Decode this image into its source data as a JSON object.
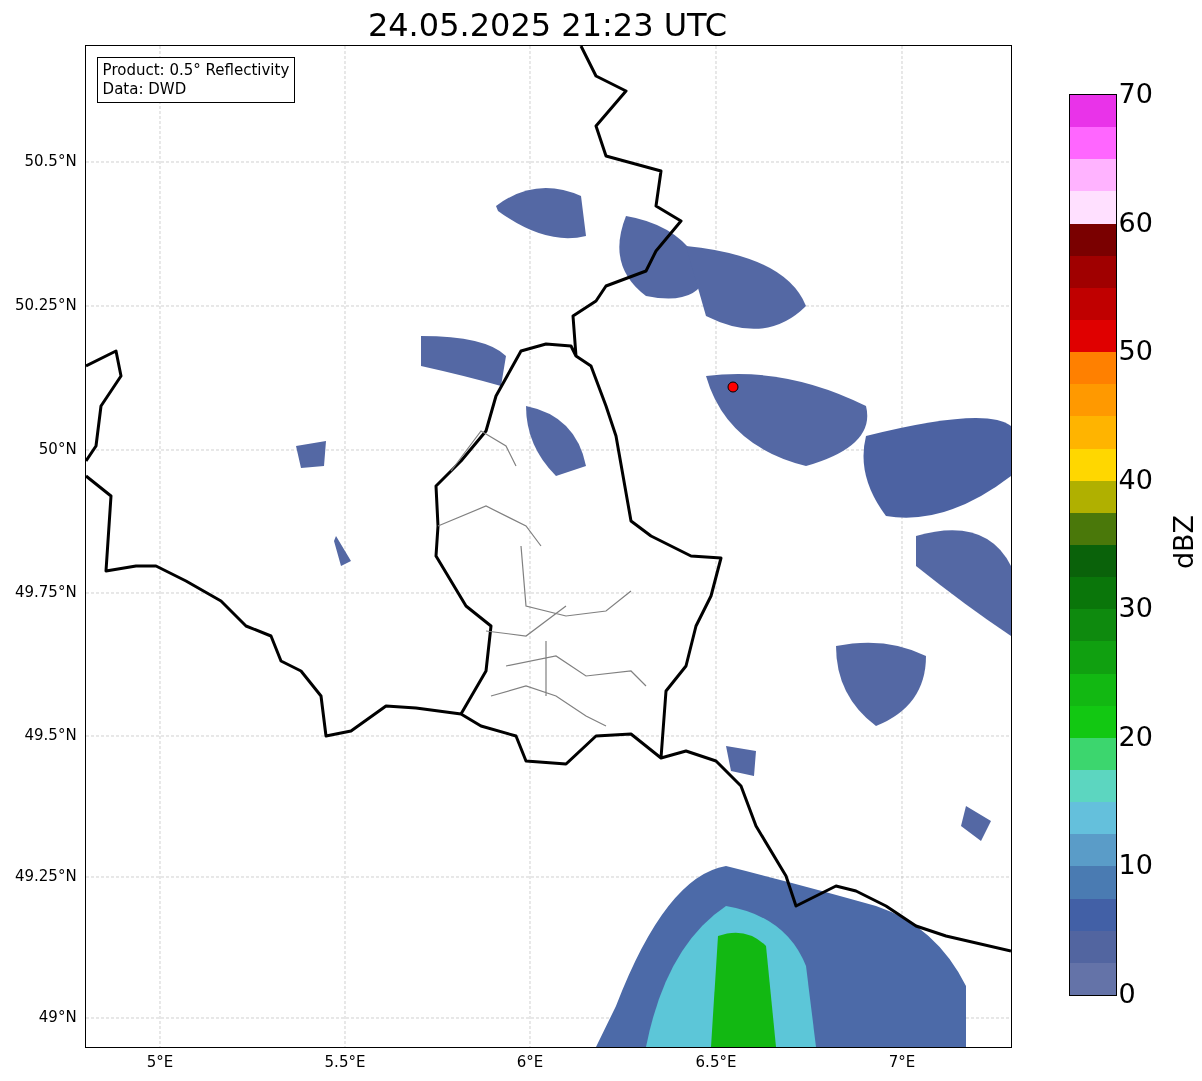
{
  "title": "24.05.2025 21:23 UTC",
  "info_box": [
    "Product: 0.5° Reflectivity",
    "Data: DWD"
  ],
  "map": {
    "y_ticks": [
      "50.5°N",
      "50.25°N",
      "50°N",
      "49.75°N",
      "49.5°N",
      "49.25°N",
      "49°N"
    ],
    "x_ticks": [
      "5°E",
      "5.5°E",
      "6°E",
      "6.5°E",
      "7°E"
    ]
  },
  "colorbar": {
    "label": "dBZ",
    "ticks": [
      "70",
      "60",
      "50",
      "40",
      "30",
      "20",
      "10",
      "0"
    ],
    "bins": [
      {
        "color": "#e933e9"
      },
      {
        "color": "#ff66ff"
      },
      {
        "color": "#ffb3ff"
      },
      {
        "color": "#ffe0ff"
      },
      {
        "color": "#7a0000"
      },
      {
        "color": "#a00000"
      },
      {
        "color": "#c00000"
      },
      {
        "color": "#e00000"
      },
      {
        "color": "#ff8000"
      },
      {
        "color": "#ff9900"
      },
      {
        "color": "#ffb400"
      },
      {
        "color": "#ffd700"
      },
      {
        "color": "#b0b000"
      },
      {
        "color": "#4a780a"
      },
      {
        "color": "#0a620a"
      },
      {
        "color": "#0a760a"
      },
      {
        "color": "#0e8a0e"
      },
      {
        "color": "#10a010"
      },
      {
        "color": "#12b812"
      },
      {
        "color": "#12c812"
      },
      {
        "color": "#3cd66e"
      },
      {
        "color": "#5cd6c0"
      },
      {
        "color": "#64c0dc"
      },
      {
        "color": "#5a9cc8"
      },
      {
        "color": "#4a7bb2"
      },
      {
        "color": "#4260a6"
      },
      {
        "color": "#5265a0"
      },
      {
        "color": "#6473a8"
      }
    ]
  }
}
